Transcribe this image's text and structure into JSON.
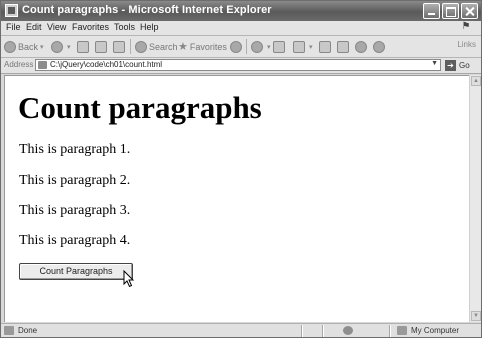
{
  "window": {
    "title": "Count paragraphs - Microsoft Internet Explorer"
  },
  "menubar": {
    "items": [
      "File",
      "Edit",
      "View",
      "Favorites",
      "Tools",
      "Help"
    ]
  },
  "toolbar": {
    "back_label": "Back",
    "search_label": "Search",
    "favorites_label": "Favorites",
    "links_label": "Links"
  },
  "addressbar": {
    "label": "Address",
    "url": "C:\\jQuery\\code\\ch01\\count.html",
    "go_label": "Go"
  },
  "page": {
    "heading": "Count paragraphs",
    "paragraphs": [
      "This is paragraph 1.",
      "This is paragraph 2.",
      "This is paragraph 3.",
      "This is paragraph 4."
    ],
    "button_label": "Count Paragraphs"
  },
  "statusbar": {
    "status": "Done",
    "zone": "My Computer"
  },
  "icons": {
    "back": "back-arrow-icon",
    "forward": "forward-arrow-icon",
    "stop": "stop-icon",
    "refresh": "refresh-icon",
    "home": "home-icon",
    "search": "search-icon",
    "favorites": "favorites-star-icon",
    "media": "media-icon",
    "history": "history-icon",
    "mail": "mail-icon",
    "print": "print-icon",
    "edit": "edit-icon",
    "discuss": "discuss-icon",
    "messenger": "messenger-icon"
  }
}
